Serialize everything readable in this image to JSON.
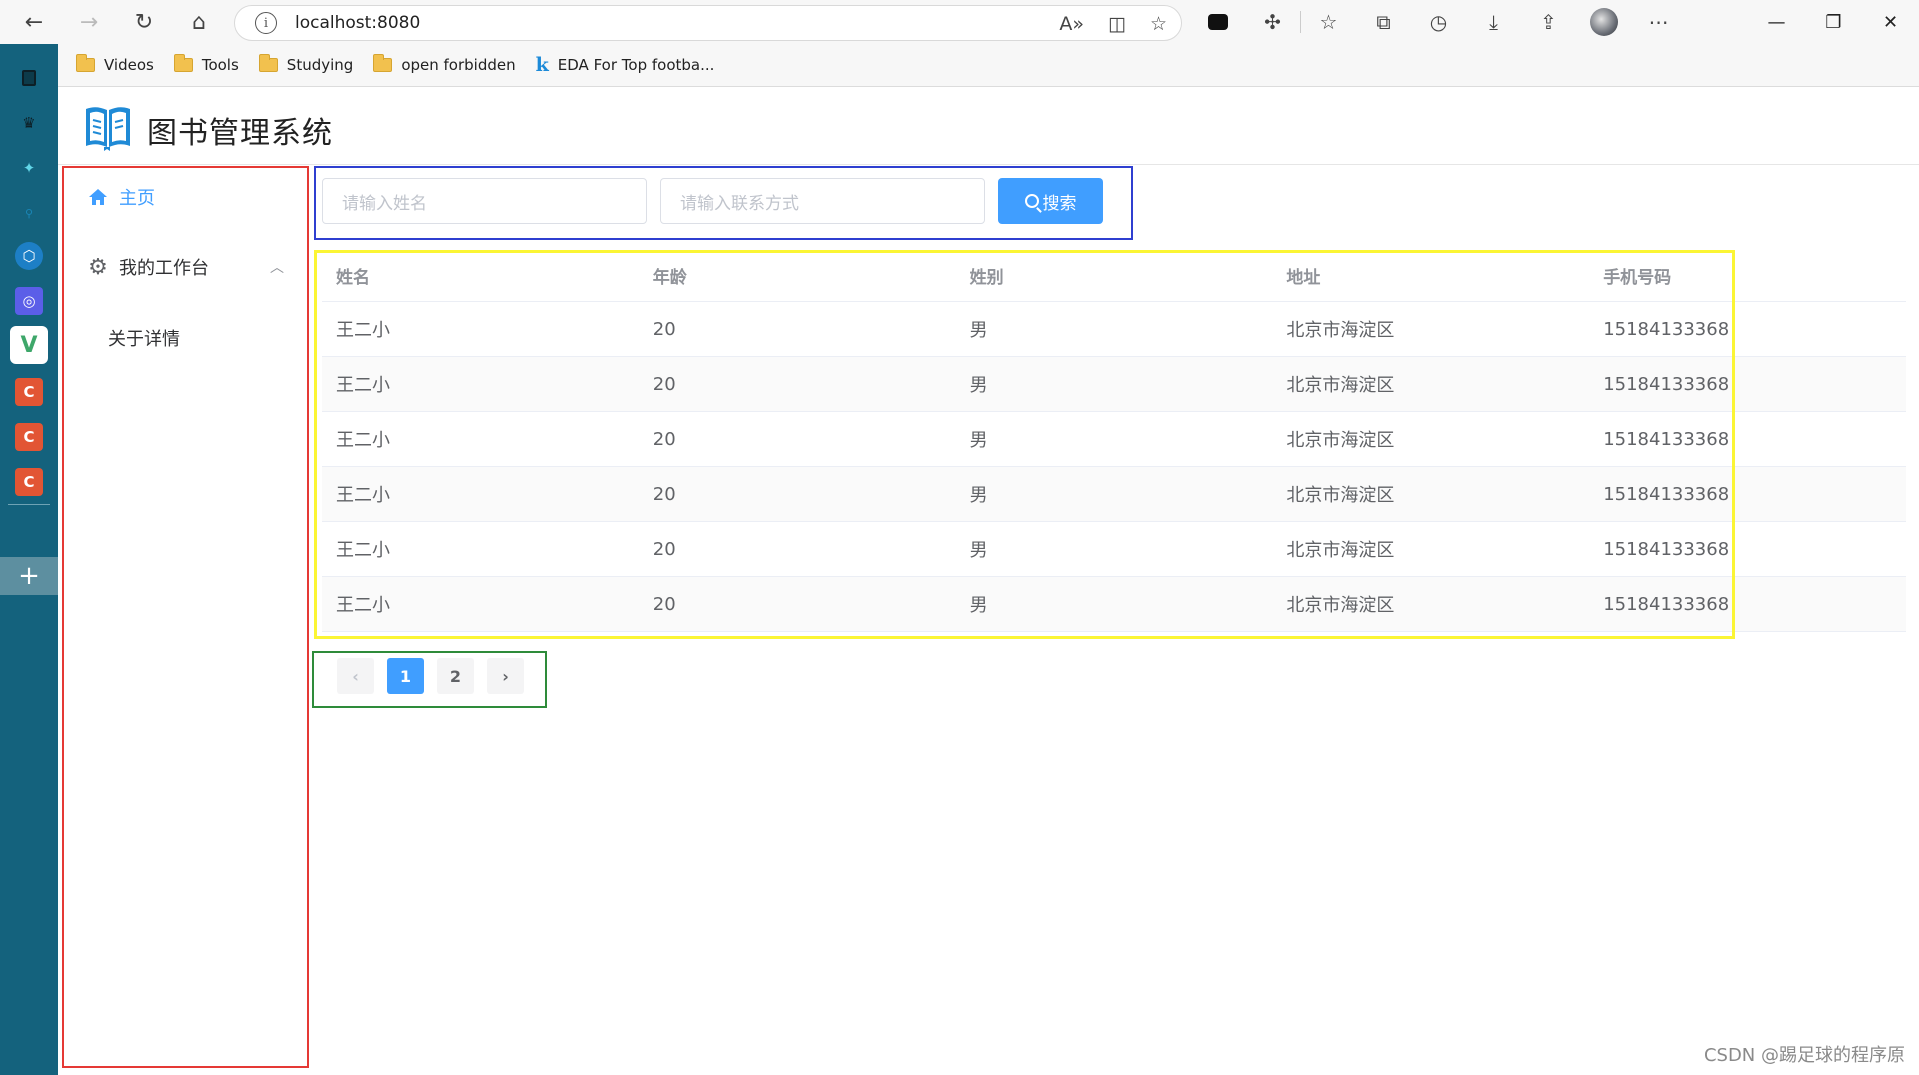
{
  "browser": {
    "url": "localhost:8080",
    "bookmarks": [
      {
        "label": "Videos",
        "type": "folder"
      },
      {
        "label": "Tools",
        "type": "folder"
      },
      {
        "label": "Studying",
        "type": "folder"
      },
      {
        "label": "open forbidden",
        "type": "folder"
      },
      {
        "label": "EDA For Top footba...",
        "type": "k-link"
      }
    ]
  },
  "app": {
    "title": "图书管理系统",
    "accent_color": "#409eff"
  },
  "menu": {
    "home": "主页",
    "workbench": "我的工作台",
    "about": "关于详情"
  },
  "search": {
    "name_placeholder": "请输入姓名",
    "contact_placeholder": "请输入联系方式",
    "button_label": "搜索"
  },
  "table": {
    "headers": [
      "姓名",
      "年龄",
      "姓别",
      "地址",
      "手机号码"
    ],
    "rows": [
      [
        "王二小",
        "20",
        "男",
        "北京市海淀区",
        "15184133368"
      ],
      [
        "王二小",
        "20",
        "男",
        "北京市海淀区",
        "15184133368"
      ],
      [
        "王二小",
        "20",
        "男",
        "北京市海淀区",
        "15184133368"
      ],
      [
        "王二小",
        "20",
        "男",
        "北京市海淀区",
        "15184133368"
      ],
      [
        "王二小",
        "20",
        "男",
        "北京市海淀区",
        "15184133368"
      ],
      [
        "王二小",
        "20",
        "男",
        "北京市海淀区",
        "15184133368"
      ]
    ]
  },
  "pagination": {
    "prev": "‹",
    "pages": [
      "1",
      "2"
    ],
    "current": "1",
    "next": "›"
  },
  "edge_sidebar": {
    "c_label": "C"
  },
  "watermark": "CSDN @踢足球的程序原"
}
